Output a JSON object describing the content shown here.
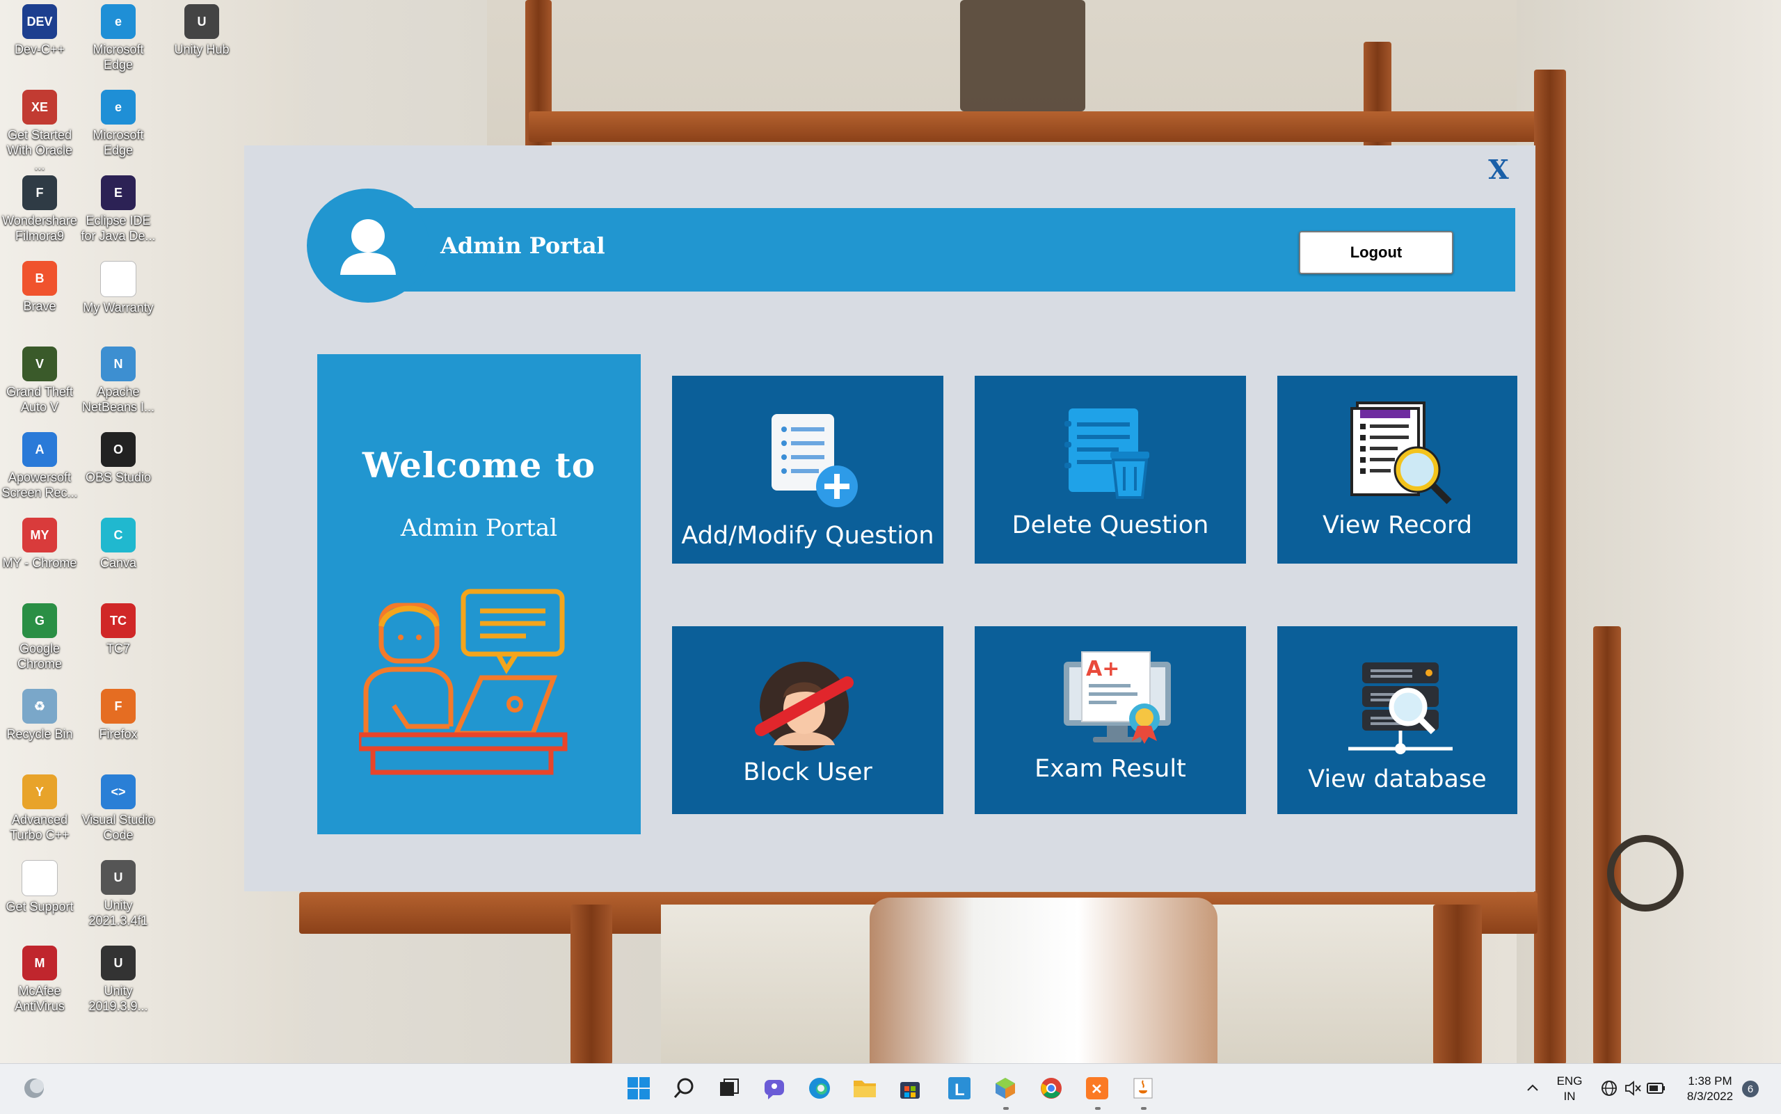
{
  "desktop": {
    "icons": [
      {
        "label": "Dev-C++",
        "glyph": "DEV",
        "color": "#1d3f8f"
      },
      {
        "label": "Microsoft Edge",
        "glyph": "e",
        "color": "#1f8fd6"
      },
      {
        "label": "Unity Hub",
        "glyph": "U",
        "color": "#444444"
      },
      {
        "label": "Get Started With Oracle ...",
        "glyph": "XE",
        "color": "#c23b32"
      },
      {
        "label": "Microsoft Edge",
        "glyph": "e",
        "color": "#1f8fd6"
      },
      {
        "label": "Wondershare Filmora9",
        "glyph": "F",
        "color": "#2f3b45"
      },
      {
        "label": "Eclipse IDE for Java De...",
        "glyph": "E",
        "color": "#2c2255"
      },
      {
        "label": "Brave",
        "glyph": "B",
        "color": "#f0532d"
      },
      {
        "label": "My Warranty",
        "glyph": "",
        "color": "#ffffff"
      },
      {
        "label": "Grand Theft Auto V",
        "glyph": "V",
        "color": "#3a5a2a"
      },
      {
        "label": "Apache NetBeans I...",
        "glyph": "N",
        "color": "#3d8fd1"
      },
      {
        "label": "Apowersoft Screen Rec...",
        "glyph": "A",
        "color": "#2a7ad8"
      },
      {
        "label": "OBS Studio",
        "glyph": "O",
        "color": "#222222"
      },
      {
        "label": "MY - Chrome",
        "glyph": "MY",
        "color": "#d93b3b"
      },
      {
        "label": "Canva",
        "glyph": "C",
        "color": "#20b8cf"
      },
      {
        "label": "Google Chrome",
        "glyph": "G",
        "color": "#2a8f45"
      },
      {
        "label": "TC7",
        "glyph": "TC",
        "color": "#d02727"
      },
      {
        "label": "Recycle Bin",
        "glyph": "♻",
        "color": "#7aa7c9"
      },
      {
        "label": "Firefox",
        "glyph": "F",
        "color": "#e56d22"
      },
      {
        "label": "Advanced Turbo C++",
        "glyph": "Y",
        "color": "#e8a32a"
      },
      {
        "label": "Visual Studio Code",
        "glyph": "<>",
        "color": "#2a7fd6"
      },
      {
        "label": "Get Support",
        "glyph": "",
        "color": "#ffffff"
      },
      {
        "label": "Unity 2021.3.4f1",
        "glyph": "U",
        "color": "#555555"
      },
      {
        "label": "McAfee AntiVirus",
        "glyph": "M",
        "color": "#c0262d"
      },
      {
        "label": "Unity 2019.3.9...",
        "glyph": "U",
        "color": "#333333"
      }
    ]
  },
  "app": {
    "close_label": "X",
    "header": {
      "title": "Admin Portal",
      "logout_label": "Logout"
    },
    "welcome": {
      "line1": "Welcome to",
      "line2": "Admin Portal"
    },
    "tiles": [
      {
        "label": "Add/Modify Question"
      },
      {
        "label": "Delete Question"
      },
      {
        "label": "View Record"
      },
      {
        "label": "Block User"
      },
      {
        "label": "Exam Result"
      },
      {
        "label": "View database"
      }
    ],
    "colors": {
      "panel": "#2196d0",
      "tile": "#0b5f99",
      "window": "#d8dce3"
    }
  },
  "taskbar": {
    "apps": [
      "start-icon",
      "search-icon",
      "task-view-icon",
      "chat-icon",
      "edge-icon",
      "file-explorer-icon",
      "store-icon",
      "l-app-icon",
      "netbeans-icon",
      "chrome-icon",
      "xampp-icon",
      "java-icon"
    ],
    "lang_top": "ENG",
    "lang_bottom": "IN",
    "time": "1:38 PM",
    "date": "8/3/2022",
    "notification_count": "6"
  }
}
